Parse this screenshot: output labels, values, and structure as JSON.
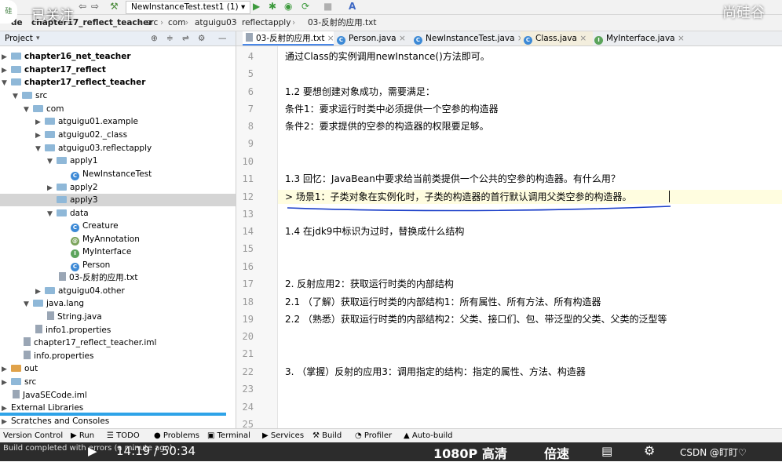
{
  "overlay": {
    "cancel_follow": "已关注",
    "brand": "尚硅谷",
    "time": "14:19 / 50:34",
    "quality": "1080P 高清",
    "speed": "倍速",
    "watermark": "CSDN @盯盯♡"
  },
  "toolbar": {
    "run_config": "NewInstanceTest.test1 (1)"
  },
  "breadcrumb": [
    "de",
    "chapter17_reflect_teacher",
    "src",
    "com",
    "atguigu03",
    "reflectapply",
    "03-反射的应用.txt"
  ],
  "project_panel": {
    "title": "Project"
  },
  "tree": [
    {
      "label": "chapter16_net_teacher"
    },
    {
      "label": "chapter17_reflect"
    },
    {
      "label": "chapter17_reflect_teacher"
    },
    {
      "label": "src"
    },
    {
      "label": "com"
    },
    {
      "label": "atguigu01.example"
    },
    {
      "label": "atguigu02._class"
    },
    {
      "label": "atguigu03.reflectapply"
    },
    {
      "label": "apply1"
    },
    {
      "label": "NewInstanceTest"
    },
    {
      "label": "apply2"
    },
    {
      "label": "apply3"
    },
    {
      "label": "data"
    },
    {
      "label": "Creature"
    },
    {
      "label": "MyAnnotation"
    },
    {
      "label": "MyInterface"
    },
    {
      "label": "Person"
    },
    {
      "label": "03-反射的应用.txt"
    },
    {
      "label": "atguigu04.other"
    },
    {
      "label": "java.lang"
    },
    {
      "label": "String.java"
    },
    {
      "label": "info1.properties"
    },
    {
      "label": "chapter17_reflect_teacher.iml"
    },
    {
      "label": "info.properties"
    },
    {
      "label": "out"
    },
    {
      "label": "src"
    },
    {
      "label": "JavaSECode.iml"
    },
    {
      "label": "External Libraries"
    },
    {
      "label": "Scratches and Consoles"
    }
  ],
  "editor_tabs": [
    {
      "label": "03-反射的应用.txt"
    },
    {
      "label": "Person.java"
    },
    {
      "label": "NewInstanceTest.java"
    },
    {
      "label": "Class.java"
    },
    {
      "label": "MyInterface.java"
    }
  ],
  "lines": [
    {
      "num": "4",
      "text": "通过Class的实例调用newInstance()方法即可。"
    },
    {
      "num": "5",
      "text": ""
    },
    {
      "num": "6",
      "text": "1.2 要想创建对象成功，需要满足："
    },
    {
      "num": "7",
      "text": "条件1：要求运行时类中必须提供一个空参的构造器"
    },
    {
      "num": "8",
      "text": "条件2：要求提供的空参的构造器的权限要足够。"
    },
    {
      "num": "9",
      "text": ""
    },
    {
      "num": "10",
      "text": ""
    },
    {
      "num": "11",
      "text": "1.3 回忆：JavaBean中要求给当前类提供一个公共的空参的构造器。有什么用？"
    },
    {
      "num": "12",
      "text": "> 场景1：子类对象在实例化时，子类的构造器的首行默认调用父类空参的构造器。"
    },
    {
      "num": "13",
      "text": ""
    },
    {
      "num": "14",
      "text": "1.4 在jdk9中标识为过时，替换成什么结构"
    },
    {
      "num": "15",
      "text": ""
    },
    {
      "num": "16",
      "text": ""
    },
    {
      "num": "17",
      "text": "2. 反射应用2：获取运行时类的内部结构"
    },
    {
      "num": "18",
      "text": "2.1 （了解）获取运行时类的内部结构1：所有属性、所有方法、所有构造器"
    },
    {
      "num": "19",
      "text": "2.2 （熟悉）获取运行时类的内部结构2：父类、接口们、包、带泛型的父类、父类的泛型等"
    },
    {
      "num": "20",
      "text": ""
    },
    {
      "num": "21",
      "text": ""
    },
    {
      "num": "22",
      "text": "3. （掌握）反射的应用3：调用指定的结构：指定的属性、方法、构造器"
    },
    {
      "num": "23",
      "text": ""
    },
    {
      "num": "24",
      "text": ""
    },
    {
      "num": "25",
      "text": ""
    }
  ],
  "bottom_tools": [
    "Version Control",
    "Run",
    "TODO",
    "Problems",
    "Terminal",
    "Services",
    "Build",
    "Profiler",
    "Auto-build"
  ],
  "status": {
    "message": "Build completed with errors (a minute ago)"
  }
}
